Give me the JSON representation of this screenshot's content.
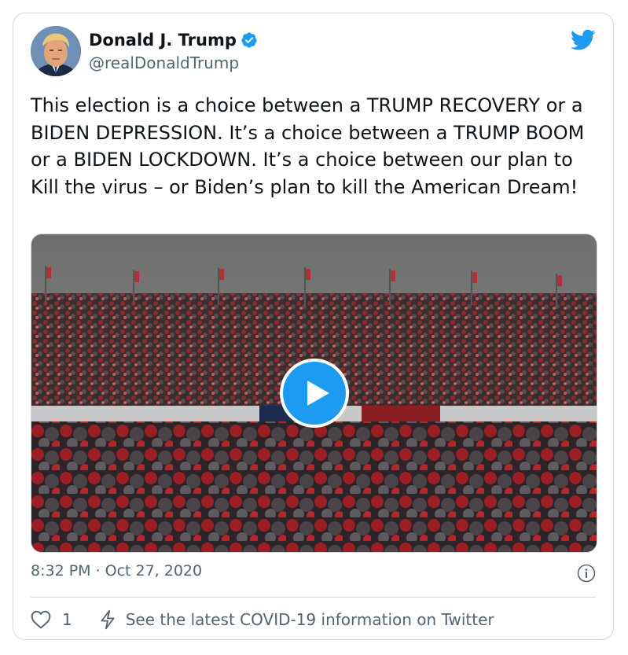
{
  "tweet": {
    "display_name": "Donald J. Trump",
    "handle": "@realDonaldTrump",
    "text": "This election is a choice between a TRUMP RECOVERY or a BIDEN DEPRESSION. It’s a choice between a TRUMP BOOM or a BIDEN LOCKDOWN. It’s a choice between our plan to Kill the virus – or Biden’s plan to kill the American Dream!",
    "time": "8:32 PM",
    "separator": "·",
    "date": "Oct 27, 2020",
    "like_count": "1",
    "covid_link": "See the latest COVID-19 information on Twitter"
  },
  "icons": {
    "verified": "verified-badge-icon",
    "brand": "twitter-bird-icon",
    "play": "play-icon",
    "info": "info-icon",
    "like": "heart-icon",
    "covid": "lightning-icon"
  },
  "colors": {
    "brand": "#1d9bf0",
    "text": "#0f1419",
    "secondary": "#536471",
    "border": "#cfd9de"
  }
}
